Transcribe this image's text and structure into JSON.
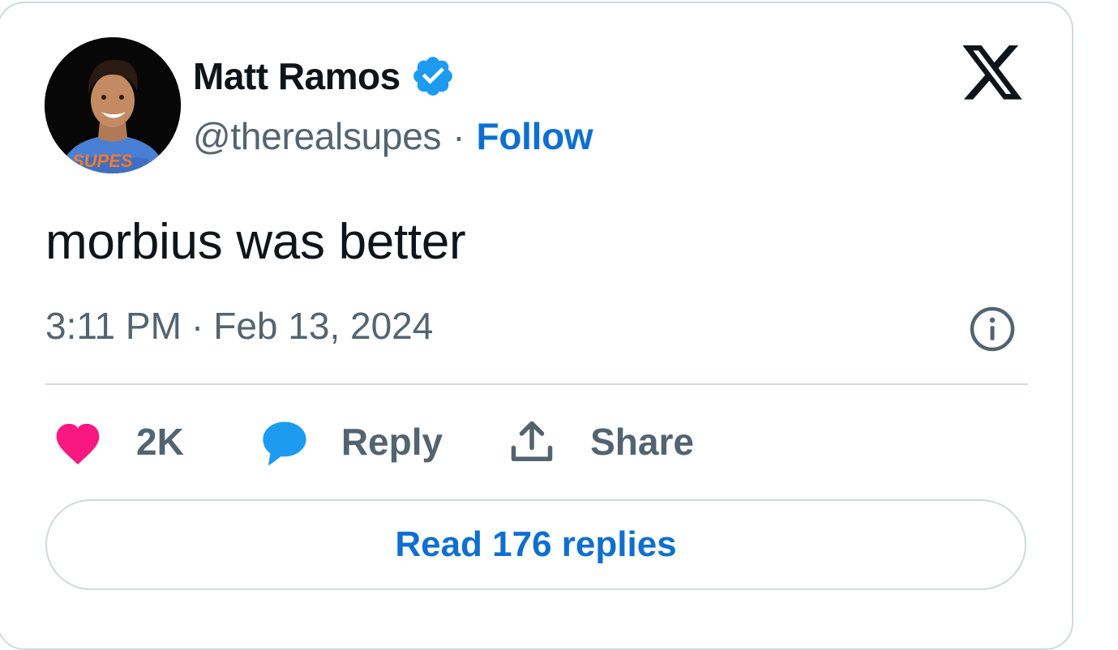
{
  "author": {
    "display_name": "Matt Ramos",
    "handle": "@therealsupes",
    "separator": "·",
    "follow_label": "Follow",
    "verified": true,
    "avatar_shirt_text": "SUPES"
  },
  "tweet": {
    "text": "morbius was better",
    "time": "3:11 PM",
    "separator": "·",
    "date": "Feb 13, 2024"
  },
  "actions": {
    "like_count": "2K",
    "reply_label": "Reply",
    "share_label": "Share"
  },
  "footer": {
    "read_replies_label": "Read 176 replies"
  },
  "icons": {
    "platform": "x-logo-icon",
    "verified": "verified-badge-icon",
    "info": "info-icon",
    "like": "heart-icon",
    "reply": "speech-bubble-icon",
    "share": "upload-icon"
  },
  "colors": {
    "text_primary": "#0f1419",
    "text_secondary": "#536471",
    "link": "#0f6fd0",
    "verified": "#1d9bf0",
    "heart": "#f91880",
    "reply_bubble": "#1d9bf0",
    "border": "#cfd9de"
  }
}
